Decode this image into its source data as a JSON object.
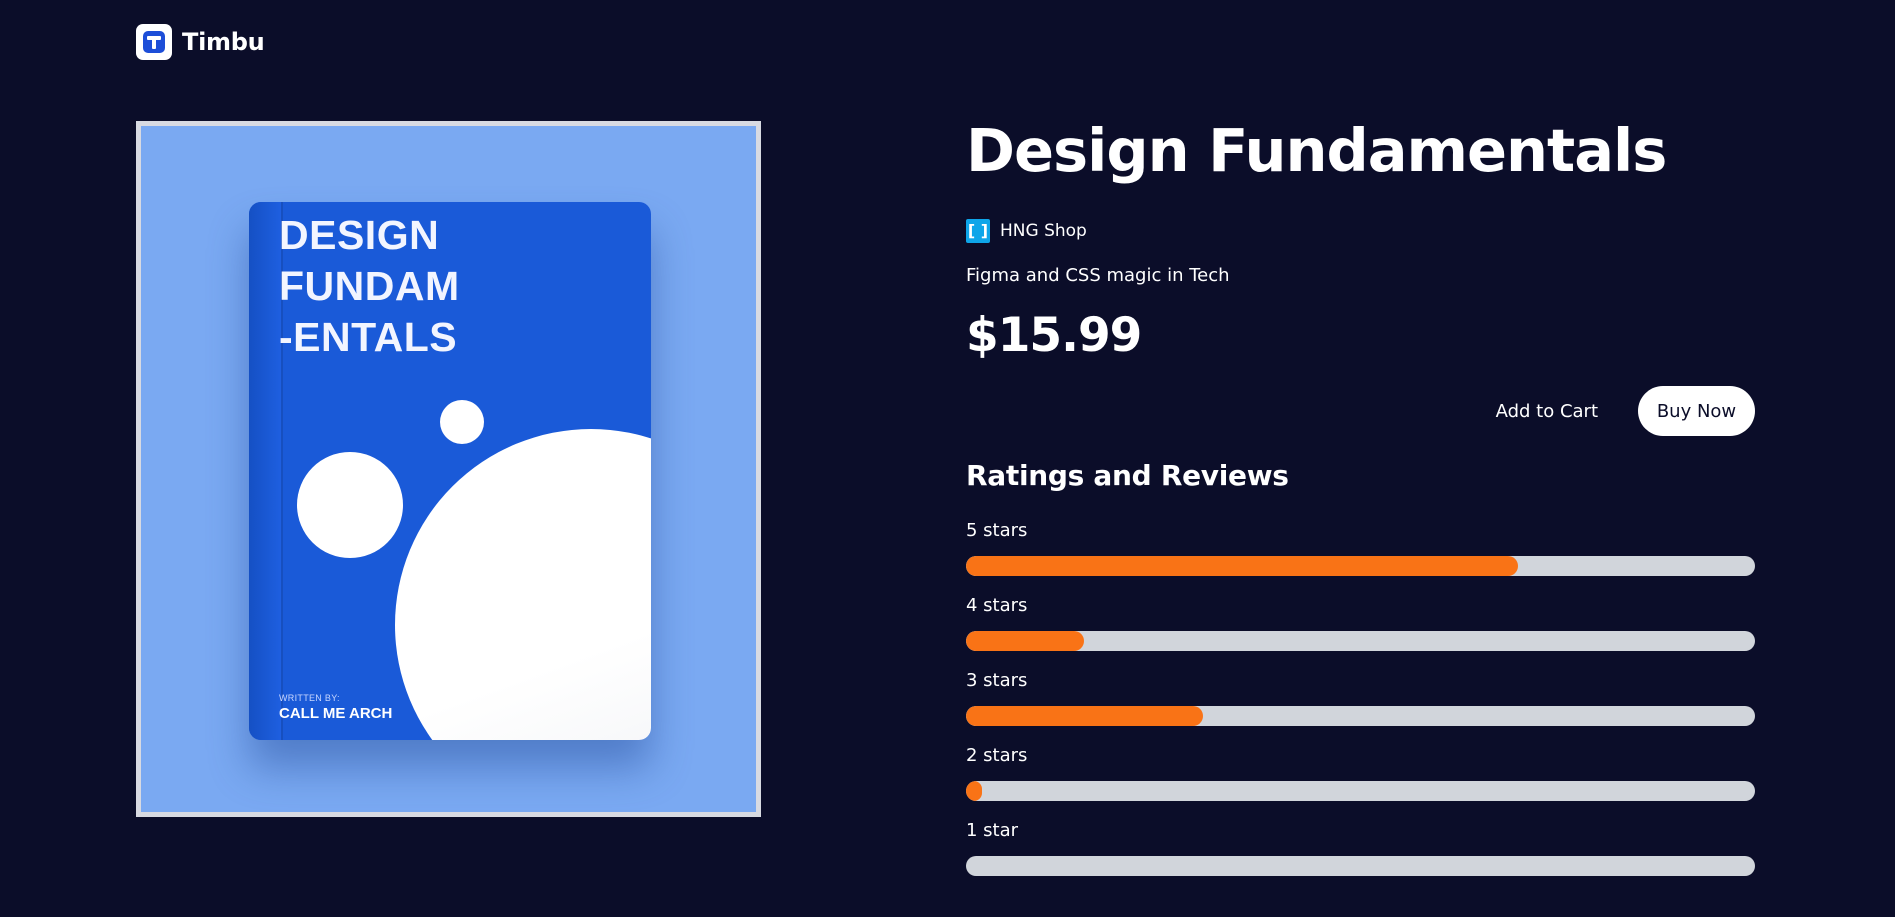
{
  "header": {
    "brand": "Timbu"
  },
  "product": {
    "title": "Design Fundamentals",
    "shop_name": "HNG Shop",
    "shop_icon_glyph": "[ ]",
    "description": "Figma and CSS magic in Tech",
    "price": "$15.99",
    "cover": {
      "title_lines": [
        "DESIGN",
        "FUNDAM",
        "-ENTALS"
      ],
      "written_by": "WRITTEN BY:",
      "author": "CALL ME ARCH",
      "colors": {
        "background": "#7aa9f2",
        "cover": "#1a5ad8"
      }
    }
  },
  "actions": {
    "add_to_cart": "Add to Cart",
    "buy_now": "Buy Now"
  },
  "ratings": {
    "title": "Ratings and Reviews",
    "items": [
      {
        "label": "5 stars",
        "fraction": 0.7
      },
      {
        "label": "4 stars",
        "fraction": 0.15
      },
      {
        "label": "3 stars",
        "fraction": 0.3
      },
      {
        "label": "2 stars",
        "fraction": 0.02
      },
      {
        "label": "1 star",
        "fraction": 0.0
      }
    ],
    "colors": {
      "fill": "#f97316",
      "track": "#d1d5db"
    }
  }
}
